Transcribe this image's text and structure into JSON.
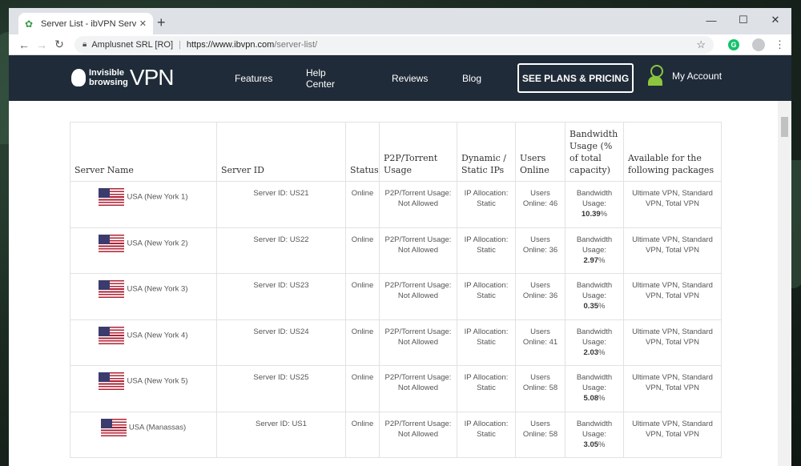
{
  "browser": {
    "tab_title": "Server List - ibVPN Server Netw",
    "newtab_label": "+",
    "site_org": "Amplusnet SRL [RO]",
    "url_host": "https://www.ibvpn.com",
    "url_path": "/server-list/",
    "ext_label": "G"
  },
  "site": {
    "logo_line1": "Invisible",
    "logo_line2": "browsing",
    "logo_vpn": "VPN",
    "nav": [
      "Features",
      "Help Center",
      "Reviews",
      "Blog"
    ],
    "cta": "SEE PLANS & PRICING",
    "account": "My Account"
  },
  "table": {
    "headers": {
      "name": "Server Name",
      "id": "Server ID",
      "status": "Status",
      "p2p": "P2P/Torrent Usage",
      "ip": "Dynamic / Static IPs",
      "users": "Users Online",
      "bw": "Bandwidth Usage (% of total capacity)",
      "pkg": "Available for the following packages"
    },
    "rows": [
      {
        "name": "USA (New York 1)",
        "id": "Server ID: US21",
        "status": "Online",
        "p2p": "P2P/Torrent Usage: Not Allowed",
        "ip": "IP Allocation: Static",
        "users_label": "Users Online:",
        "users": "46",
        "bw_label": "Bandwidth Usage:",
        "bw": "10.39",
        "pkg": "Ultimate VPN, Standard VPN, Total VPN"
      },
      {
        "name": "USA (New York 2)",
        "id": "Server ID: US22",
        "status": "Online",
        "p2p": "P2P/Torrent Usage: Not Allowed",
        "ip": "IP Allocation: Static",
        "users_label": "Users Online:",
        "users": "36",
        "bw_label": "Bandwidth Usage:",
        "bw": "2.97",
        "pkg": "Ultimate VPN, Standard VPN, Total VPN"
      },
      {
        "name": "USA (New York 3)",
        "id": "Server ID: US23",
        "status": "Online",
        "p2p": "P2P/Torrent Usage: Not Allowed",
        "ip": "IP Allocation: Static",
        "users_label": "Users Online:",
        "users": "36",
        "bw_label": "Bandwidth Usage:",
        "bw": "0.35",
        "pkg": "Ultimate VPN, Standard VPN, Total VPN"
      },
      {
        "name": "USA (New York 4)",
        "id": "Server ID: US24",
        "status": "Online",
        "p2p": "P2P/Torrent Usage: Not Allowed",
        "ip": "IP Allocation: Static",
        "users_label": "Users Online:",
        "users": "41",
        "bw_label": "Bandwidth Usage:",
        "bw": "2.03",
        "pkg": "Ultimate VPN, Standard VPN, Total VPN"
      },
      {
        "name": "USA (New York 5)",
        "id": "Server ID: US25",
        "status": "Online",
        "p2p": "P2P/Torrent Usage: Not Allowed",
        "ip": "IP Allocation: Static",
        "users_label": "Users Online:",
        "users": "58",
        "bw_label": "Bandwidth Usage:",
        "bw": "5.08",
        "pkg": "Ultimate VPN, Standard VPN, Total VPN"
      },
      {
        "name": "USA (Manassas)",
        "id": "Server ID: US1",
        "status": "Online",
        "p2p": "P2P/Torrent Usage: Not Allowed",
        "ip": "IP Allocation: Static",
        "users_label": "Users Online:",
        "users": "58",
        "bw_label": "Bandwidth Usage:",
        "bw": "3.05",
        "pkg": "Ultimate VPN, Standard VPN, Total VPN"
      }
    ]
  },
  "colors": {
    "nav_bg": "#1f2b38",
    "accent_green": "#8cc63f"
  }
}
